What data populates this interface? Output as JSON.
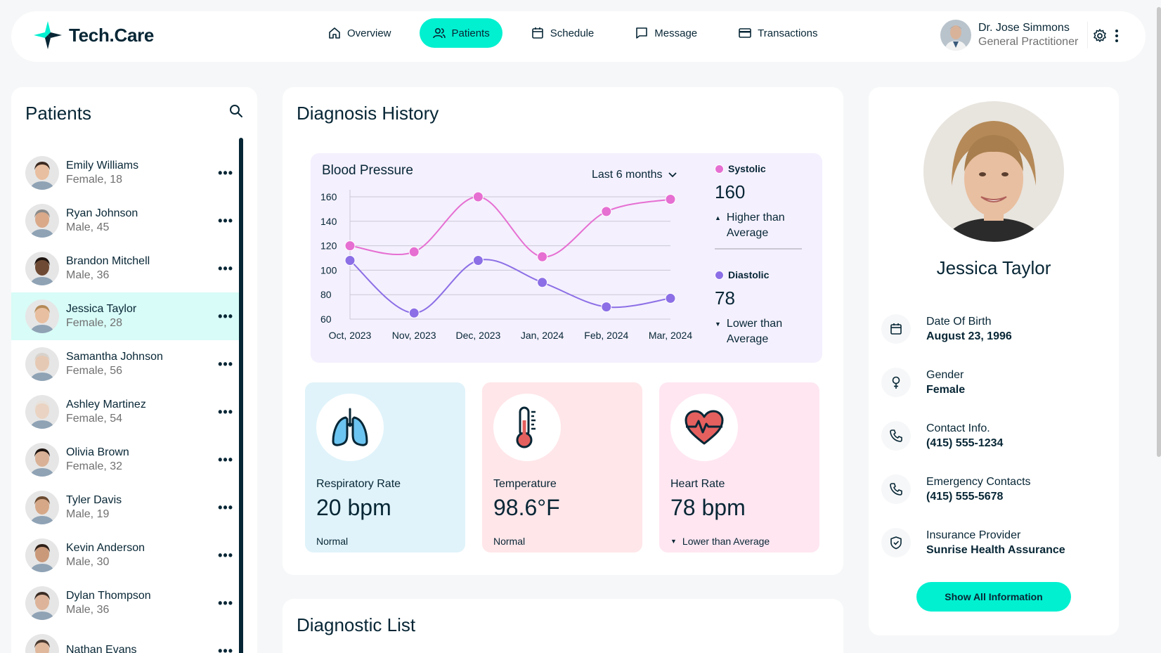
{
  "app": {
    "name": "Tech.Care"
  },
  "nav": {
    "items": [
      {
        "label": "Overview",
        "icon": "home-icon",
        "active": false
      },
      {
        "label": "Patients",
        "icon": "users-icon",
        "active": true
      },
      {
        "label": "Schedule",
        "icon": "calendar-icon",
        "active": false
      },
      {
        "label": "Message",
        "icon": "message-icon",
        "active": false
      },
      {
        "label": "Transactions",
        "icon": "credit-card-icon",
        "active": false
      }
    ]
  },
  "doctor": {
    "name": "Dr. Jose Simmons",
    "role": "General Practitioner"
  },
  "patients": {
    "title": "Patients",
    "list": [
      {
        "name": "Emily Williams",
        "meta": "Female, 18",
        "active": false
      },
      {
        "name": "Ryan Johnson",
        "meta": "Male, 45",
        "active": false
      },
      {
        "name": "Brandon Mitchell",
        "meta": "Male, 36",
        "active": false
      },
      {
        "name": "Jessica Taylor",
        "meta": "Female, 28",
        "active": true
      },
      {
        "name": "Samantha Johnson",
        "meta": "Female, 56",
        "active": false
      },
      {
        "name": "Ashley Martinez",
        "meta": "Female, 54",
        "active": false
      },
      {
        "name": "Olivia Brown",
        "meta": "Female, 32",
        "active": false
      },
      {
        "name": "Tyler Davis",
        "meta": "Male, 19",
        "active": false
      },
      {
        "name": "Kevin Anderson",
        "meta": "Male, 30",
        "active": false
      },
      {
        "name": "Dylan Thompson",
        "meta": "Male, 36",
        "active": false
      },
      {
        "name": "Nathan Evans",
        "meta": "",
        "active": false
      }
    ]
  },
  "diagnosis": {
    "title": "Diagnosis History",
    "bp_title": "Blood Pressure",
    "range": "Last 6 months",
    "systolic": {
      "label": "Systolic",
      "value": "160",
      "note": "Higher than Average",
      "color": "#E66FD2"
    },
    "diastolic": {
      "label": "Diastolic",
      "value": "78",
      "note": "Lower than Average",
      "color": "#8C6FE6"
    },
    "vitals": [
      {
        "label": "Respiratory Rate",
        "value": "20 bpm",
        "status": "Normal",
        "bg": "#E0F3FA",
        "icon": "lungs-icon"
      },
      {
        "label": "Temperature",
        "value": "98.6°F",
        "status": "Normal",
        "bg": "#FFE6E9",
        "icon": "thermometer-icon"
      },
      {
        "label": "Heart Rate",
        "value": "78 bpm",
        "status": "Lower than Average",
        "bg": "#FFE6F1",
        "icon": "heart-icon"
      }
    ]
  },
  "chart_data": {
    "type": "line",
    "title": "Blood Pressure",
    "categories": [
      "Oct, 2023",
      "Nov, 2023",
      "Dec, 2023",
      "Jan, 2024",
      "Feb, 2024",
      "Mar, 2024"
    ],
    "series": [
      {
        "name": "Systolic",
        "values": [
          120,
          115,
          160,
          111,
          148,
          158
        ],
        "color": "#E66FD2"
      },
      {
        "name": "Diastolic",
        "values": [
          108,
          65,
          108,
          90,
          70,
          77
        ],
        "color": "#8C6FE6"
      }
    ],
    "yticks": [
      60,
      80,
      100,
      120,
      140,
      160
    ],
    "ylim": [
      60,
      180
    ],
    "grid": true
  },
  "diagnostic_list": {
    "title": "Diagnostic List"
  },
  "profile": {
    "name": "Jessica Taylor",
    "fields": [
      {
        "key": "Date Of Birth",
        "value": "August 23, 1996",
        "icon": "calendar-icon"
      },
      {
        "key": "Gender",
        "value": "Female",
        "icon": "female-icon"
      },
      {
        "key": "Contact Info.",
        "value": "(415) 555-1234",
        "icon": "phone-icon"
      },
      {
        "key": "Emergency Contacts",
        "value": "(415) 555-5678",
        "icon": "phone-icon"
      },
      {
        "key": "Insurance Provider",
        "value": "Sunrise Health Assurance",
        "icon": "shield-icon"
      }
    ],
    "button": "Show All Information"
  }
}
